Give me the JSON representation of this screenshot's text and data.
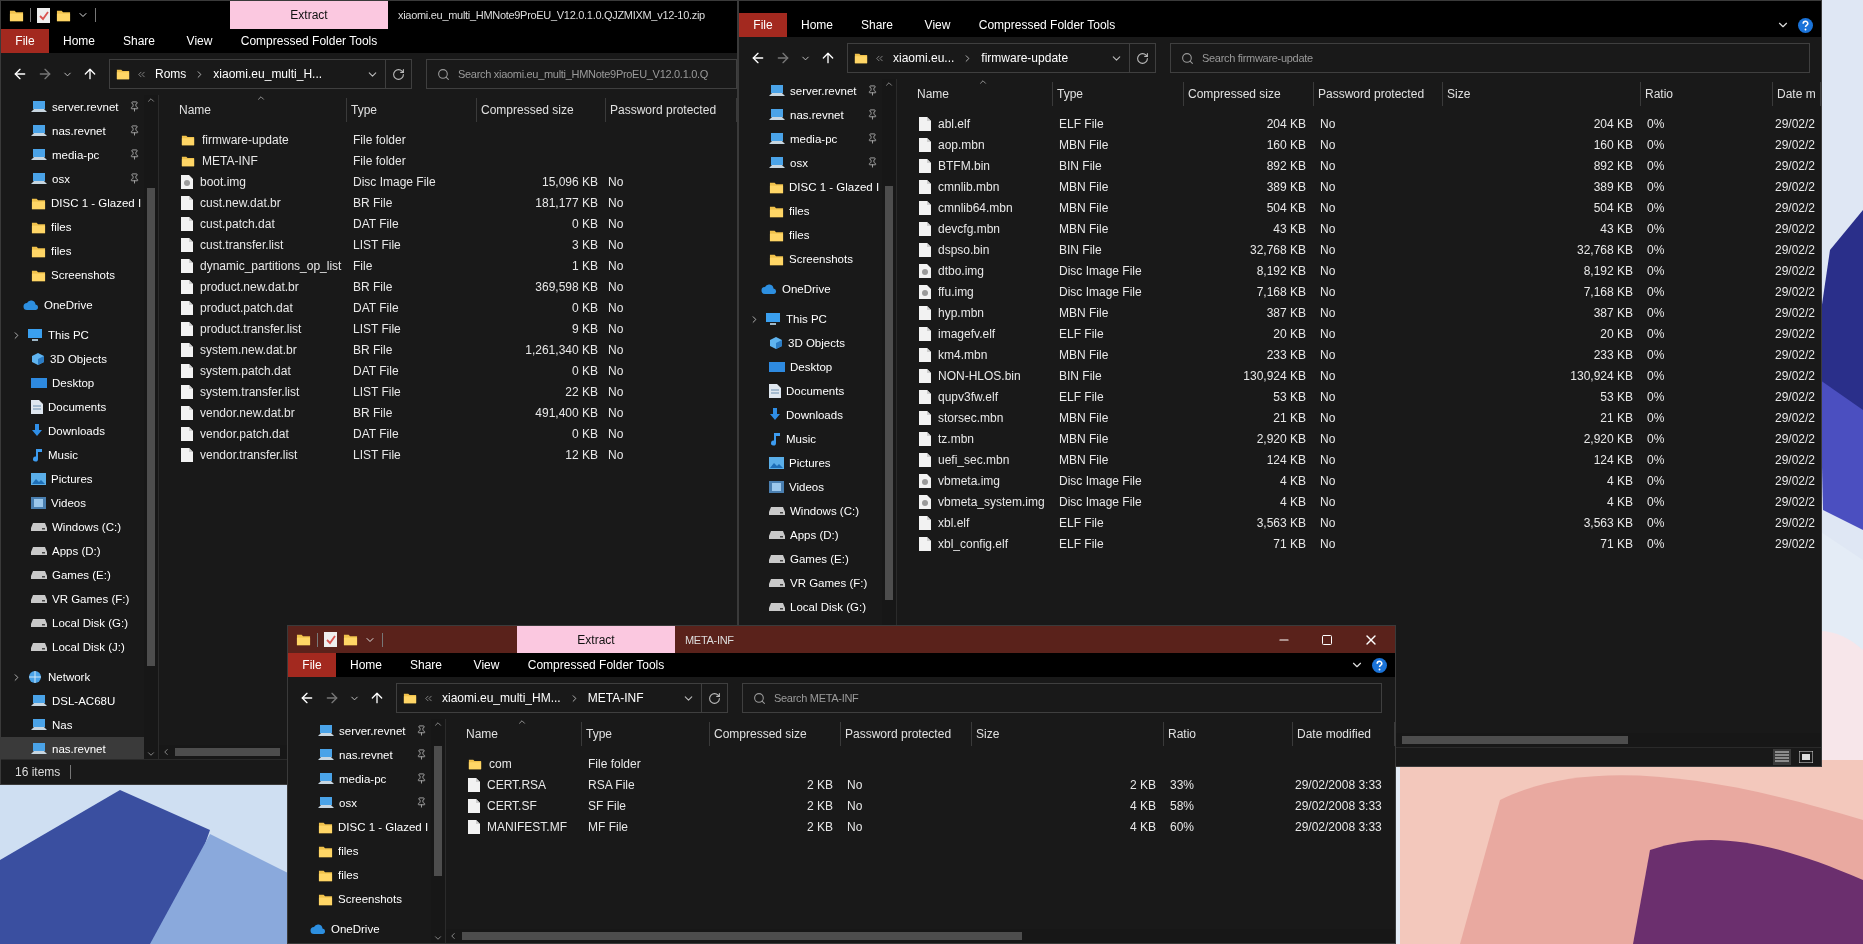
{
  "windows": [
    {
      "title": "xiaomi.eu_multi_HMNote9ProEU_V12.0.1.0.QJZMIXM_v12-10.zip",
      "context_tab": "Extract",
      "active": false,
      "ribbon_tabs": [
        {
          "label": "File",
          "kind": "file"
        },
        {
          "label": "Home",
          "kind": "tab"
        },
        {
          "label": "Share",
          "kind": "tab"
        },
        {
          "label": "View",
          "kind": "tab"
        },
        {
          "label": "Compressed Folder Tools",
          "kind": "tab"
        }
      ],
      "address": [
        "Roms",
        "xiaomi.eu_multi_H..."
      ],
      "search": {
        "placeholder": "Search xiaomi.eu_multi_HMNote9ProEU_V12.0.1.0.Q"
      },
      "nav": [
        {
          "label": "server.revnet",
          "kind": "computer",
          "pinned": true,
          "selected": false
        },
        {
          "label": "nas.revnet",
          "kind": "computer",
          "pinned": true,
          "selected": false
        },
        {
          "label": "media-pc",
          "kind": "computer",
          "pinned": true,
          "selected": false
        },
        {
          "label": "osx",
          "kind": "computer",
          "pinned": true,
          "selected": false
        },
        {
          "label": "DISC 1 - Glazed I",
          "kind": "folder",
          "pinned": false,
          "selected": false
        },
        {
          "label": "files",
          "kind": "folder",
          "pinned": false,
          "selected": false
        },
        {
          "label": "files",
          "kind": "folder",
          "pinned": false,
          "selected": false
        },
        {
          "label": "Screenshots",
          "kind": "folder",
          "pinned": false,
          "selected": false
        },
        {
          "label": "OneDrive",
          "kind": "cloud",
          "pinned": false,
          "selected": false
        },
        {
          "label": "This PC",
          "kind": "pc",
          "pinned": false,
          "selected": false,
          "children": [
            {
              "label": "3D Objects",
              "kind": "cube",
              "selected": false
            },
            {
              "label": "Desktop",
              "kind": "desktop",
              "selected": false
            },
            {
              "label": "Documents",
              "kind": "documents",
              "selected": false
            },
            {
              "label": "Downloads",
              "kind": "downloads",
              "selected": false
            },
            {
              "label": "Music",
              "kind": "music",
              "selected": false
            },
            {
              "label": "Pictures",
              "kind": "pictures",
              "selected": false
            },
            {
              "label": "Videos",
              "kind": "videos",
              "selected": false
            },
            {
              "label": "Windows (C:)",
              "kind": "drive",
              "selected": false
            },
            {
              "label": "Apps (D:)",
              "kind": "drive",
              "selected": false
            },
            {
              "label": "Games (E:)",
              "kind": "drive",
              "selected": false
            },
            {
              "label": "VR Games (F:)",
              "kind": "drive",
              "selected": false
            },
            {
              "label": "Local Disk (G:)",
              "kind": "drive",
              "selected": false
            },
            {
              "label": "Local Disk (J:)",
              "kind": "drive",
              "selected": false
            }
          ]
        },
        {
          "label": "Network",
          "kind": "network",
          "pinned": false,
          "selected": false,
          "children": [
            {
              "label": "DSL-AC68U",
              "kind": "computer",
              "selected": false
            },
            {
              "label": "Nas",
              "kind": "computer",
              "selected": false
            },
            {
              "label": "nas.revnet",
              "kind": "computer",
              "selected": true
            }
          ]
        }
      ],
      "columns": [
        {
          "label": "Name",
          "numeric": false
        },
        {
          "label": "Type",
          "numeric": false
        },
        {
          "label": "Compressed size",
          "numeric": true
        },
        {
          "label": "Password protected",
          "numeric": false
        }
      ],
      "rows": [
        {
          "kind": "folder",
          "cells": [
            "firmware-update",
            "File folder"
          ]
        },
        {
          "kind": "folder",
          "cells": [
            "META-INF",
            "File folder"
          ]
        },
        {
          "kind": "disc",
          "cells": [
            "boot.img",
            "Disc Image File",
            "15,096 KB",
            "No"
          ]
        },
        {
          "kind": "file",
          "cells": [
            "cust.new.dat.br",
            "BR File",
            "181,177 KB",
            "No"
          ]
        },
        {
          "kind": "file",
          "cells": [
            "cust.patch.dat",
            "DAT File",
            "0 KB",
            "No"
          ]
        },
        {
          "kind": "file",
          "cells": [
            "cust.transfer.list",
            "LIST File",
            "3 KB",
            "No"
          ]
        },
        {
          "kind": "file",
          "cells": [
            "dynamic_partitions_op_list",
            "File",
            "1 KB",
            "No"
          ]
        },
        {
          "kind": "file",
          "cells": [
            "product.new.dat.br",
            "BR File",
            "369,598 KB",
            "No"
          ]
        },
        {
          "kind": "file",
          "cells": [
            "product.patch.dat",
            "DAT File",
            "0 KB",
            "No"
          ]
        },
        {
          "kind": "file",
          "cells": [
            "product.transfer.list",
            "LIST File",
            "9 KB",
            "No"
          ]
        },
        {
          "kind": "file",
          "cells": [
            "system.new.dat.br",
            "BR File",
            "1,261,340 KB",
            "No"
          ]
        },
        {
          "kind": "file",
          "cells": [
            "system.patch.dat",
            "DAT File",
            "0 KB",
            "No"
          ]
        },
        {
          "kind": "file",
          "cells": [
            "system.transfer.list",
            "LIST File",
            "22 KB",
            "No"
          ]
        },
        {
          "kind": "file",
          "cells": [
            "vendor.new.dat.br",
            "BR File",
            "491,400 KB",
            "No"
          ]
        },
        {
          "kind": "file",
          "cells": [
            "vendor.patch.dat",
            "DAT File",
            "0 KB",
            "No"
          ]
        },
        {
          "kind": "file",
          "cells": [
            "vendor.transfer.list",
            "LIST File",
            "12 KB",
            "No"
          ]
        }
      ],
      "status": "16 items"
    },
    {
      "active": false,
      "ribbon_help": true,
      "ribbon_tabs": [
        {
          "label": "File",
          "kind": "file"
        },
        {
          "label": "Home",
          "kind": "tab"
        },
        {
          "label": "Share",
          "kind": "tab"
        },
        {
          "label": "View",
          "kind": "tab"
        },
        {
          "label": "Compressed Folder Tools",
          "kind": "tab"
        }
      ],
      "address": [
        "xiaomi.eu...",
        "firmware-update"
      ],
      "search": {
        "placeholder": "Search firmware-update"
      },
      "nav": [
        {
          "label": "server.revnet",
          "kind": "computer",
          "pinned": true,
          "selected": false
        },
        {
          "label": "nas.revnet",
          "kind": "computer",
          "pinned": true,
          "selected": false
        },
        {
          "label": "media-pc",
          "kind": "computer",
          "pinned": true,
          "selected": false
        },
        {
          "label": "osx",
          "kind": "computer",
          "pinned": true,
          "selected": false
        },
        {
          "label": "DISC 1 - Glazed I",
          "kind": "folder",
          "pinned": false,
          "selected": false
        },
        {
          "label": "files",
          "kind": "folder",
          "pinned": false,
          "selected": false
        },
        {
          "label": "files",
          "kind": "folder",
          "pinned": false,
          "selected": false
        },
        {
          "label": "Screenshots",
          "kind": "folder",
          "pinned": false,
          "selected": false
        },
        {
          "label": "OneDrive",
          "kind": "cloud",
          "pinned": false,
          "selected": false
        },
        {
          "label": "This PC",
          "kind": "pc",
          "pinned": false,
          "selected": false,
          "children": [
            {
              "label": "3D Objects",
              "kind": "cube",
              "selected": false
            },
            {
              "label": "Desktop",
              "kind": "desktop",
              "selected": false
            },
            {
              "label": "Documents",
              "kind": "documents",
              "selected": false
            },
            {
              "label": "Downloads",
              "kind": "downloads",
              "selected": false
            },
            {
              "label": "Music",
              "kind": "music",
              "selected": false
            },
            {
              "label": "Pictures",
              "kind": "pictures",
              "selected": false
            },
            {
              "label": "Videos",
              "kind": "videos",
              "selected": false
            },
            {
              "label": "Windows (C:)",
              "kind": "drive",
              "selected": false
            },
            {
              "label": "Apps (D:)",
              "kind": "drive",
              "selected": false
            },
            {
              "label": "Games (E:)",
              "kind": "drive",
              "selected": false
            },
            {
              "label": "VR Games (F:)",
              "kind": "drive",
              "selected": false
            },
            {
              "label": "Local Disk (G:)",
              "kind": "drive",
              "selected": false
            }
          ]
        }
      ],
      "columns": [
        {
          "label": "Name",
          "numeric": false
        },
        {
          "label": "Type",
          "numeric": false
        },
        {
          "label": "Compressed size",
          "numeric": true
        },
        {
          "label": "Password protected",
          "numeric": false
        },
        {
          "label": "Size",
          "numeric": true
        },
        {
          "label": "Ratio",
          "numeric": false
        },
        {
          "label": "Date m",
          "numeric": false
        }
      ],
      "rows": [
        {
          "kind": "file",
          "cells": [
            "abl.elf",
            "ELF File",
            "204 KB",
            "No",
            "204 KB",
            "0%",
            "29/02/2"
          ]
        },
        {
          "kind": "file",
          "cells": [
            "aop.mbn",
            "MBN File",
            "160 KB",
            "No",
            "160 KB",
            "0%",
            "29/02/2"
          ]
        },
        {
          "kind": "file",
          "cells": [
            "BTFM.bin",
            "BIN File",
            "892 KB",
            "No",
            "892 KB",
            "0%",
            "29/02/2"
          ]
        },
        {
          "kind": "file",
          "cells": [
            "cmnlib.mbn",
            "MBN File",
            "389 KB",
            "No",
            "389 KB",
            "0%",
            "29/02/2"
          ]
        },
        {
          "kind": "file",
          "cells": [
            "cmnlib64.mbn",
            "MBN File",
            "504 KB",
            "No",
            "504 KB",
            "0%",
            "29/02/2"
          ]
        },
        {
          "kind": "file",
          "cells": [
            "devcfg.mbn",
            "MBN File",
            "43 KB",
            "No",
            "43 KB",
            "0%",
            "29/02/2"
          ]
        },
        {
          "kind": "file",
          "cells": [
            "dspso.bin",
            "BIN File",
            "32,768 KB",
            "No",
            "32,768 KB",
            "0%",
            "29/02/2"
          ]
        },
        {
          "kind": "disc",
          "cells": [
            "dtbo.img",
            "Disc Image File",
            "8,192 KB",
            "No",
            "8,192 KB",
            "0%",
            "29/02/2"
          ]
        },
        {
          "kind": "disc",
          "cells": [
            "ffu.img",
            "Disc Image File",
            "7,168 KB",
            "No",
            "7,168 KB",
            "0%",
            "29/02/2"
          ]
        },
        {
          "kind": "file",
          "cells": [
            "hyp.mbn",
            "MBN File",
            "387 KB",
            "No",
            "387 KB",
            "0%",
            "29/02/2"
          ]
        },
        {
          "kind": "file",
          "cells": [
            "imagefv.elf",
            "ELF File",
            "20 KB",
            "No",
            "20 KB",
            "0%",
            "29/02/2"
          ]
        },
        {
          "kind": "file",
          "cells": [
            "km4.mbn",
            "MBN File",
            "233 KB",
            "No",
            "233 KB",
            "0%",
            "29/02/2"
          ]
        },
        {
          "kind": "file",
          "cells": [
            "NON-HLOS.bin",
            "BIN File",
            "130,924 KB",
            "No",
            "130,924 KB",
            "0%",
            "29/02/2"
          ]
        },
        {
          "kind": "file",
          "cells": [
            "qupv3fw.elf",
            "ELF File",
            "53 KB",
            "No",
            "53 KB",
            "0%",
            "29/02/2"
          ]
        },
        {
          "kind": "file",
          "cells": [
            "storsec.mbn",
            "MBN File",
            "21 KB",
            "No",
            "21 KB",
            "0%",
            "29/02/2"
          ]
        },
        {
          "kind": "file",
          "cells": [
            "tz.mbn",
            "MBN File",
            "2,920 KB",
            "No",
            "2,920 KB",
            "0%",
            "29/02/2"
          ]
        },
        {
          "kind": "file",
          "cells": [
            "uefi_sec.mbn",
            "MBN File",
            "124 KB",
            "No",
            "124 KB",
            "0%",
            "29/02/2"
          ]
        },
        {
          "kind": "disc",
          "cells": [
            "vbmeta.img",
            "Disc Image File",
            "4 KB",
            "No",
            "4 KB",
            "0%",
            "29/02/2"
          ]
        },
        {
          "kind": "disc",
          "cells": [
            "vbmeta_system.img",
            "Disc Image File",
            "4 KB",
            "No",
            "4 KB",
            "0%",
            "29/02/2"
          ]
        },
        {
          "kind": "file",
          "cells": [
            "xbl.elf",
            "ELF File",
            "3,563 KB",
            "No",
            "3,563 KB",
            "0%",
            "29/02/2"
          ]
        },
        {
          "kind": "file",
          "cells": [
            "xbl_config.elf",
            "ELF File",
            "71 KB",
            "No",
            "71 KB",
            "0%",
            "29/02/2"
          ]
        }
      ]
    },
    {
      "title": "META-INF",
      "context_tab": "Extract",
      "active": true,
      "ribbon_help": true,
      "window_controls": true,
      "ribbon_tabs": [
        {
          "label": "File",
          "kind": "file"
        },
        {
          "label": "Home",
          "kind": "tab"
        },
        {
          "label": "Share",
          "kind": "tab"
        },
        {
          "label": "View",
          "kind": "tab"
        },
        {
          "label": "Compressed Folder Tools",
          "kind": "tab"
        }
      ],
      "address": [
        "xiaomi.eu_multi_HM...",
        "META-INF"
      ],
      "search": {
        "placeholder": "Search META-INF"
      },
      "nav": [
        {
          "label": "server.revnet",
          "kind": "computer",
          "pinned": true,
          "selected": false
        },
        {
          "label": "nas.revnet",
          "kind": "computer",
          "pinned": true,
          "selected": false
        },
        {
          "label": "media-pc",
          "kind": "computer",
          "pinned": true,
          "selected": false
        },
        {
          "label": "osx",
          "kind": "computer",
          "pinned": true,
          "selected": false
        },
        {
          "label": "DISC 1 - Glazed I",
          "kind": "folder",
          "pinned": false,
          "selected": false
        },
        {
          "label": "files",
          "kind": "folder",
          "pinned": false,
          "selected": false
        },
        {
          "label": "files",
          "kind": "folder",
          "pinned": false,
          "selected": false
        },
        {
          "label": "Screenshots",
          "kind": "folder",
          "pinned": false,
          "selected": false
        },
        {
          "label": "OneDrive",
          "kind": "cloud",
          "pinned": false,
          "selected": false
        }
      ],
      "columns": [
        {
          "label": "Name",
          "numeric": false
        },
        {
          "label": "Type",
          "numeric": false
        },
        {
          "label": "Compressed size",
          "numeric": true
        },
        {
          "label": "Password protected",
          "numeric": false
        },
        {
          "label": "Size",
          "numeric": true
        },
        {
          "label": "Ratio",
          "numeric": false
        },
        {
          "label": "Date modified",
          "numeric": false
        }
      ],
      "rows": [
        {
          "kind": "folder",
          "cells": [
            "com",
            "File folder"
          ]
        },
        {
          "kind": "file",
          "cells": [
            "CERT.RSA",
            "RSA File",
            "2 KB",
            "No",
            "2 KB",
            "33%",
            "29/02/2008 3:33"
          ]
        },
        {
          "kind": "file",
          "cells": [
            "CERT.SF",
            "SF File",
            "2 KB",
            "No",
            "4 KB",
            "58%",
            "29/02/2008 3:33"
          ]
        },
        {
          "kind": "file",
          "cells": [
            "MANIFEST.MF",
            "MF File",
            "2 KB",
            "No",
            "4 KB",
            "60%",
            "29/02/2008 3:33"
          ]
        }
      ]
    }
  ]
}
